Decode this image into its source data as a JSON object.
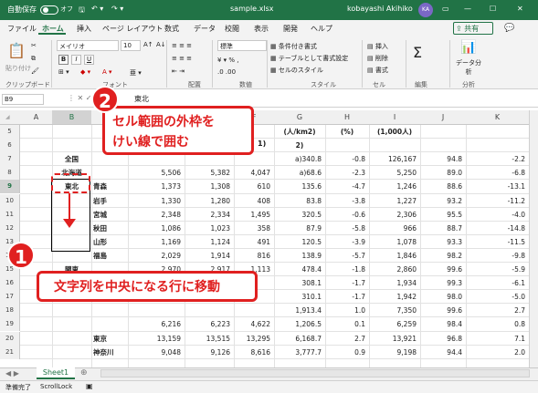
{
  "titlebar": {
    "autosave": "自動保存",
    "autosave_state": "オフ",
    "filename": "sample.xlsx",
    "user": "kobayashi Akihiko",
    "avatar": "KA"
  },
  "tabs": [
    "ファイル",
    "ホーム",
    "挿入",
    "ページ レイアウト",
    "数式",
    "データ",
    "校閲",
    "表示",
    "開発",
    "ヘルプ"
  ],
  "share": "共有",
  "ribbon": {
    "paste": "貼り付け",
    "font_name": "メイリオ",
    "font_size": "10",
    "number_format": "標準",
    "cond_format": "条件付き書式",
    "table_format": "テーブルとして書式設定",
    "cell_style": "セルのスタイル",
    "insert": "挿入",
    "delete": "削除",
    "format": "書式",
    "analyze": "データ分析",
    "groups": [
      "クリップボード",
      "フォント",
      "配置",
      "数値",
      "スタイル",
      "セル",
      "編集",
      "分析"
    ]
  },
  "formula": {
    "namebox": "B9",
    "value": "東北"
  },
  "columns": [
    "A",
    "B",
    "C",
    "D",
    "E",
    "F",
    "G",
    "H",
    "I",
    "J",
    "K"
  ],
  "rows": [
    {
      "n": "5",
      "c": {
        "G": "(人/km2)",
        "H": "(%)",
        "I": "(1,000人)"
      }
    },
    {
      "n": "6",
      "c": {
        "G": "2)"
      }
    },
    {
      "n": "7",
      "c": {
        "B": "全国",
        "G": "a)340.8",
        "H": "-0.8",
        "I": "126,167",
        "J": "94.8",
        "K": "-2.2"
      }
    },
    {
      "n": "8",
      "c": {
        "B": "北海道",
        "D": "5,506",
        "E": "5,382",
        "F": "4,047",
        "G": "a)68.6",
        "H": "-2.3",
        "I": "5,250",
        "J": "89.0",
        "K": "-6.8"
      }
    },
    {
      "n": "9",
      "c": {
        "B": "東北",
        "C": "青森",
        "D": "1,373",
        "E": "1,308",
        "F": "610",
        "G": "135.6",
        "H": "-4.7",
        "I": "1,246",
        "J": "88.6",
        "K": "-13.1"
      }
    },
    {
      "n": "10",
      "c": {
        "C": "岩手",
        "D": "1,330",
        "E": "1,280",
        "F": "408",
        "G": "83.8",
        "H": "-3.8",
        "I": "1,227",
        "J": "93.2",
        "K": "-11.2"
      }
    },
    {
      "n": "11",
      "c": {
        "C": "宮城",
        "D": "2,348",
        "E": "2,334",
        "F": "1,495",
        "G": "320.5",
        "H": "-0.6",
        "I": "2,306",
        "J": "95.5",
        "K": "-4.0"
      }
    },
    {
      "n": "12",
      "c": {
        "C": "秋田",
        "D": "1,086",
        "E": "1,023",
        "F": "358",
        "G": "87.9",
        "H": "-5.8",
        "I": "966",
        "J": "88.7",
        "K": "-14.8"
      }
    },
    {
      "n": "13",
      "c": {
        "C": "山形",
        "D": "1,169",
        "E": "1,124",
        "F": "491",
        "G": "120.5",
        "H": "-3.9",
        "I": "1,078",
        "J": "93.3",
        "K": "-11.5"
      }
    },
    {
      "n": "14",
      "c": {
        "C": "福島",
        "D": "2,029",
        "E": "1,914",
        "F": "816",
        "G": "138.9",
        "H": "-5.7",
        "I": "1,846",
        "J": "98.2",
        "K": "-9.8"
      }
    },
    {
      "n": "15",
      "c": {
        "B": "関東",
        "D": "2,970",
        "E": "2,917",
        "F": "1,113",
        "G": "478.4",
        "H": "-1.8",
        "I": "2,860",
        "J": "99.6",
        "K": "-5.9"
      }
    },
    {
      "n": "16",
      "c": {
        "G": "308.1",
        "H": "-1.7",
        "I": "1,934",
        "J": "99.3",
        "K": "-6.1"
      }
    },
    {
      "n": "17",
      "c": {
        "G": "310.1",
        "H": "-1.7",
        "I": "1,942",
        "J": "98.0",
        "K": "-5.0"
      }
    },
    {
      "n": "18",
      "c": {
        "G": "1,913.4",
        "H": "1.0",
        "I": "7,350",
        "J": "99.6",
        "K": "2.7"
      }
    },
    {
      "n": "19",
      "c": {
        "D": "6,216",
        "E": "6,223",
        "F": "4,622",
        "G": "1,206.5",
        "H": "0.1",
        "I": "6,259",
        "J": "98.4",
        "K": "0.8"
      }
    },
    {
      "n": "20",
      "c": {
        "C": "東京",
        "D": "13,159",
        "E": "13,515",
        "F": "13,295",
        "G": "6,168.7",
        "H": "2.7",
        "I": "13,921",
        "J": "96.8",
        "K": "7.1"
      }
    },
    {
      "n": "21",
      "c": {
        "C": "神奈川",
        "D": "9,048",
        "E": "9,126",
        "F": "8,616",
        "G": "3,777.7",
        "H": "0.9",
        "I": "9,198",
        "J": "94.4",
        "K": "2.0"
      }
    }
  ],
  "sheet_tab": "Sheet1",
  "status": {
    "ready": "準備完了",
    "scrolllock": "ScrollLock"
  },
  "callouts": {
    "c1": {
      "number": "1",
      "text": "文字列を中央になる行に移動"
    },
    "c2": {
      "number": "2",
      "line1": "セル範囲の外枠を",
      "line2": "けい線で囲む"
    },
    "partial_d7_suffix": "1)"
  },
  "colors": {
    "accent": "#217346",
    "callout": "#e02020"
  }
}
